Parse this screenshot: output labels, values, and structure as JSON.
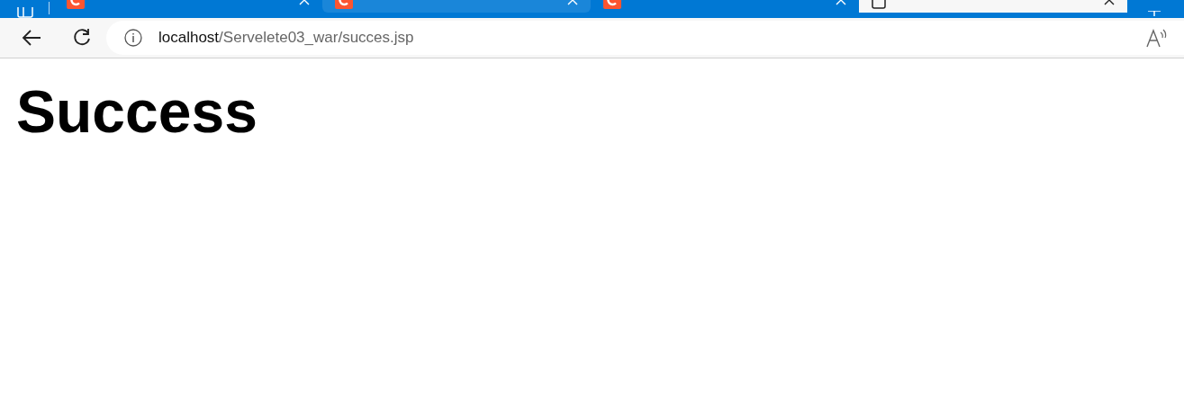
{
  "tabs": [
    {
      "selected": false,
      "hovered": false
    },
    {
      "selected": false,
      "hovered": true
    },
    {
      "selected": false,
      "hovered": false
    },
    {
      "selected": true,
      "hovered": false
    }
  ],
  "address_bar": {
    "host": "localhost",
    "path": "/Servelete03_war/succes.jsp"
  },
  "page": {
    "heading": "Success"
  }
}
